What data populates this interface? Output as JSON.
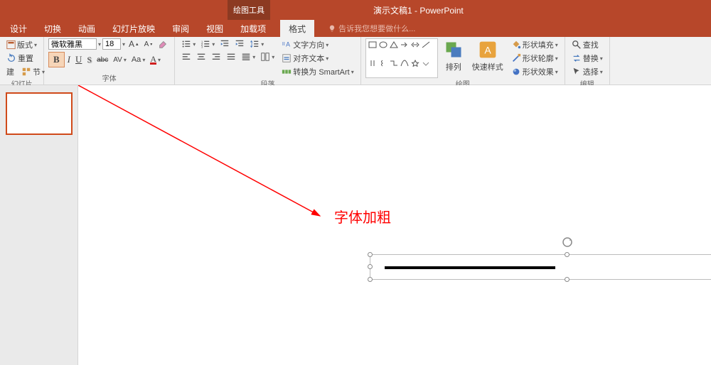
{
  "title": "演示文稿1 - PowerPoint",
  "contextual_tab": "绘图工具",
  "tabs": {
    "design": "设计",
    "transitions": "切换",
    "animations": "动画",
    "slideshow": "幻灯片放映",
    "review": "审阅",
    "view": "视图",
    "addins": "加载项",
    "format": "格式"
  },
  "tell_me": "告诉我您想要做什么...",
  "groups": {
    "slides": {
      "label": "幻灯片",
      "layout": "版式",
      "reset": "重置",
      "new": "建",
      "section": "节"
    },
    "font": {
      "label": "字体",
      "name": "微软雅黑",
      "size": "18",
      "bold": "B",
      "italic": "I",
      "underline": "U",
      "shadow": "S",
      "strike": "abc",
      "spacing": "AV",
      "case": "Aa",
      "color": "A"
    },
    "paragraph": {
      "label": "段落",
      "text_direction": "文字方向",
      "align_text": "对齐文本",
      "smartart": "转换为 SmartArt"
    },
    "drawing": {
      "label": "绘图",
      "arrange": "排列",
      "quick_styles": "快速样式",
      "shape_fill": "形状填充",
      "shape_outline": "形状轮廓",
      "shape_effects": "形状效果"
    },
    "editing": {
      "label": "编辑",
      "find": "查找",
      "replace": "替换",
      "select": "选择"
    }
  },
  "annotation": "字体加粗"
}
